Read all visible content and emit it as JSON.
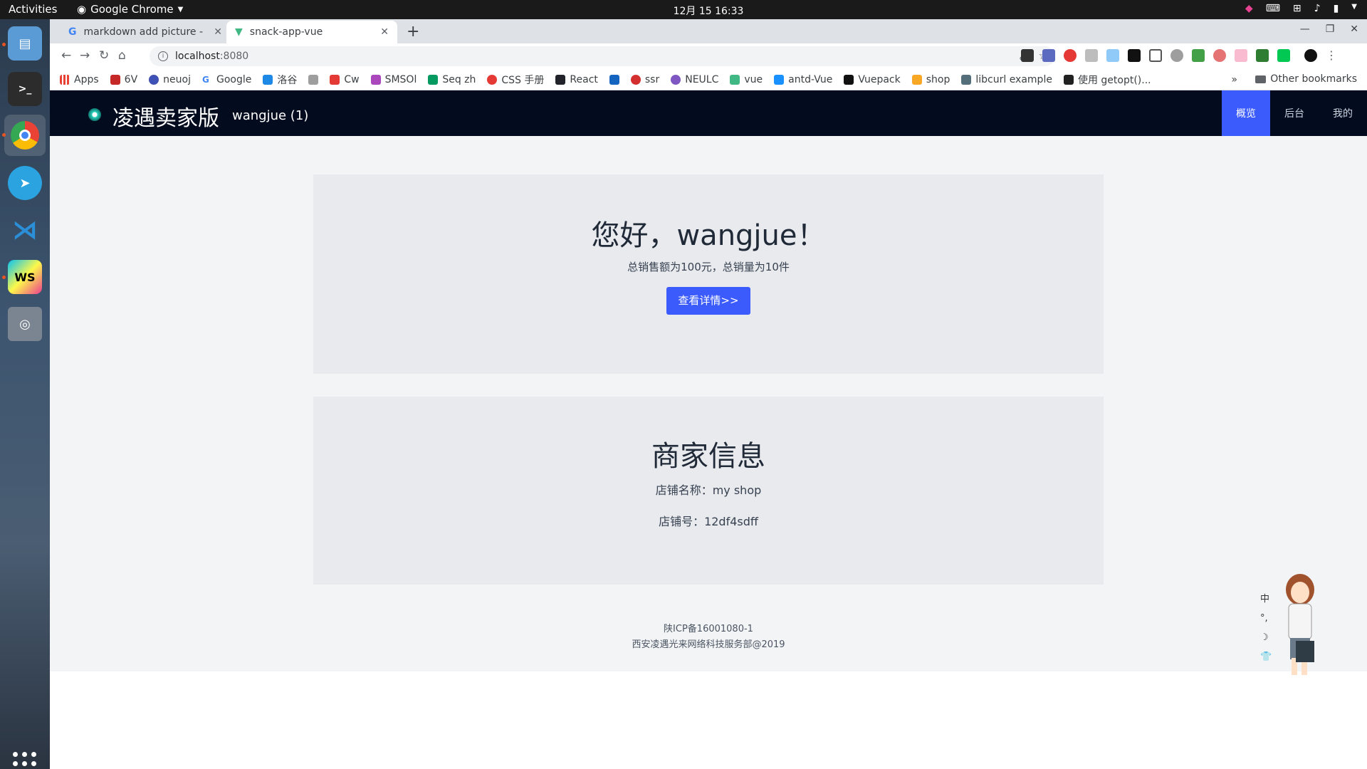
{
  "system": {
    "activities": "Activities",
    "app_name": "Google Chrome",
    "clock": "12月 15  16:33"
  },
  "browser": {
    "tabs": [
      {
        "title": "markdown add picture - G",
        "active": false
      },
      {
        "title": "snack-app-vue",
        "active": true
      }
    ],
    "url_host": "localhost",
    "url_port": ":8080",
    "bookmarks": [
      "Apps",
      "6V",
      "neuoj",
      "Google",
      "洛谷",
      "",
      "Cw",
      "SMSOl",
      "Seq zh",
      "CSS 手册",
      "React",
      "",
      "ssr",
      "NEULC",
      "vue",
      "antd-Vue",
      "Vuepack",
      "shop",
      "libcurl example",
      "使用 getopt()..."
    ],
    "bookmarks_more": "»",
    "other_bookmarks": "Other bookmarks"
  },
  "app": {
    "title": "凌遇卖家版",
    "user": "wangjue (1)",
    "nav": [
      {
        "label": "概览",
        "active": true
      },
      {
        "label": "后台",
        "active": false
      },
      {
        "label": "我的",
        "active": false
      }
    ],
    "greeting": "您好，wangjue！",
    "summary": "总销售额为100元，总销量为10件",
    "detail_button": "查看详情>>",
    "shop_section_title": "商家信息",
    "shop_name": "店铺名称：my shop",
    "shop_id": "店铺号：12df4sdff",
    "footer_icp": "陕ICP备16001080-1",
    "footer_copyright": "西安凌遇光来网络科技服务部@2019"
  },
  "ime": [
    "中",
    "°,",
    "☽",
    "👕"
  ],
  "colors": {
    "navbar_bg": "#030b1e",
    "accent": "#3b5bfd",
    "card_bg": "#e8eaed",
    "page_bg": "#f3f4f6"
  }
}
